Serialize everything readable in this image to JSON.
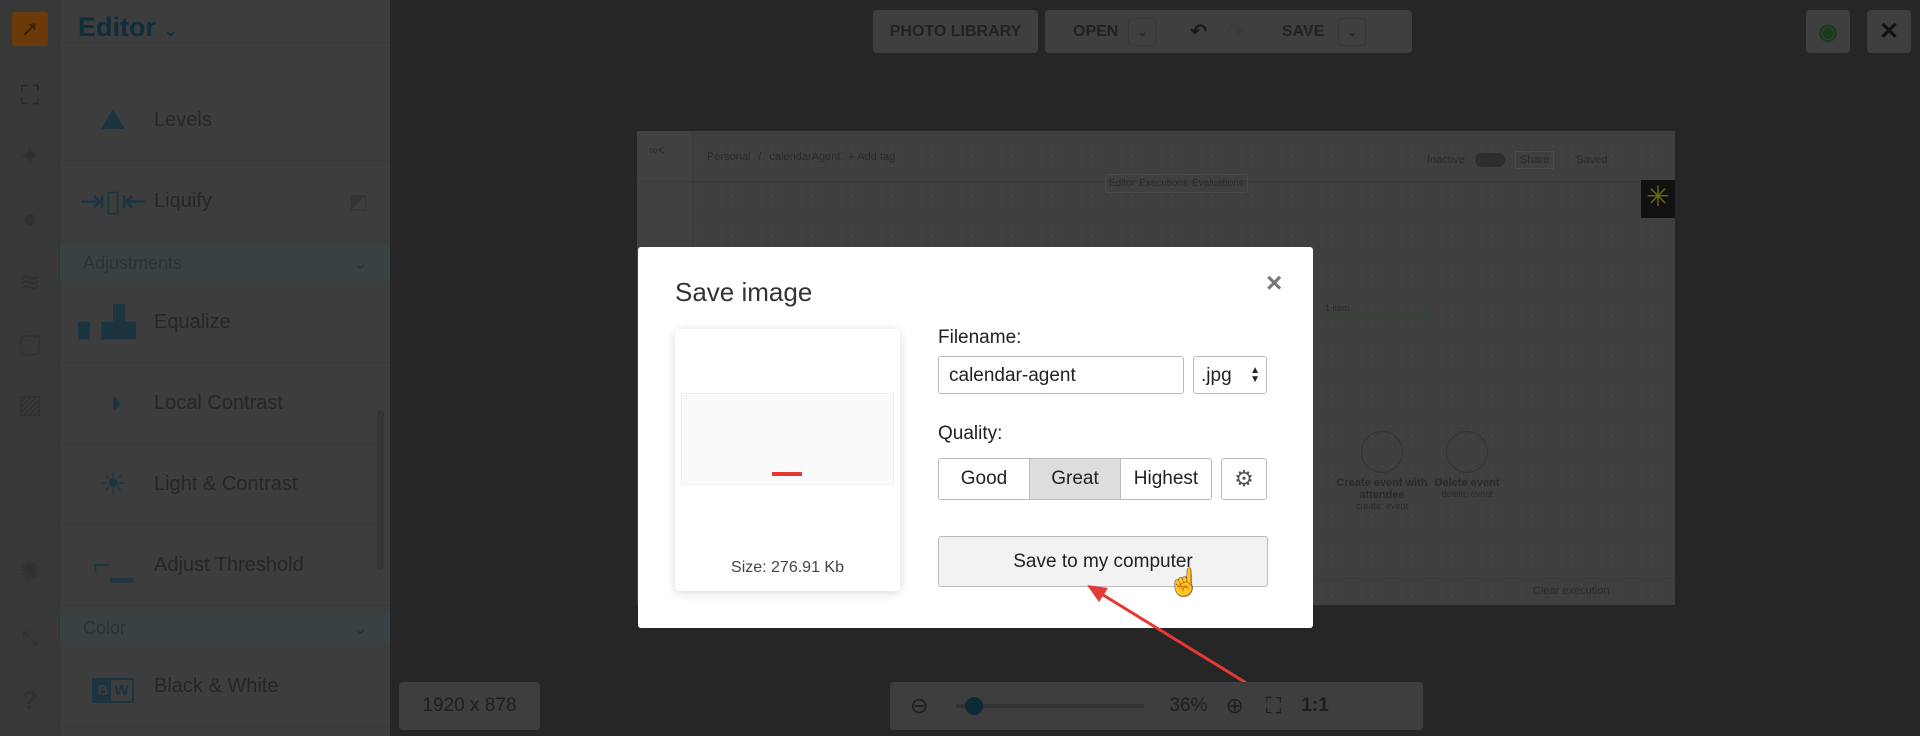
{
  "sidebar": {
    "title": "Editor",
    "tools": [
      "crop-icon",
      "magic-wand-icon",
      "face-icon",
      "layers-icon",
      "frame-icon",
      "texture-icon",
      "lightbulb-icon",
      "expand-icon",
      "help-icon"
    ],
    "items": [
      {
        "label": "Levels",
        "icon": "mountains-icon"
      },
      {
        "label": "Liquify",
        "icon": "liquify-icon"
      }
    ],
    "adjustments": {
      "header": "Adjustments",
      "items": [
        {
          "label": "Equalize"
        },
        {
          "label": "Local Contrast"
        },
        {
          "label": "Light & Contrast"
        },
        {
          "label": "Adjust Threshold"
        }
      ]
    },
    "color": {
      "header": "Color",
      "items": [
        {
          "label": "Black & White",
          "badge_b": "B",
          "badge_w": "W"
        }
      ]
    }
  },
  "toolbar": {
    "photo_library": "PHOTO LIBRARY",
    "open": "OPEN",
    "save": "SAVE"
  },
  "background_canvas": {
    "breadcrumb_personal": "Personal",
    "breadcrumb_sep": "/",
    "workflow_name": "calendarAgent",
    "add_tag": "+ Add tag",
    "tabs": [
      "Editor",
      "Executions",
      "Evaluations"
    ],
    "inactive": "Inactive",
    "share": "Share",
    "saved": "Saved",
    "item_count": "1 item",
    "nodes": [
      {
        "title": "Create event with attendee",
        "subtitle": "create: event"
      },
      {
        "title": "Delete event",
        "subtitle": "delete: event"
      }
    ],
    "clear_execution": "Clear execution"
  },
  "dialog": {
    "title": "Save image",
    "close": "×",
    "size": "Size: 276.91 Kb",
    "filename_label": "Filename:",
    "filename": "calendar-agent",
    "extension": ".jpg",
    "quality_label": "Quality:",
    "quality_options": [
      "Good",
      "Great",
      "Highest"
    ],
    "quality_selected": "Great",
    "save_button": "Save to my computer"
  },
  "footer": {
    "dimensions": "1920 x 878",
    "zoom": "36%",
    "zoom_fraction": 0.05,
    "one_to_one": "1:1"
  },
  "colors": {
    "accent": "#0f2e3d",
    "annotation_arrow": "#e53935",
    "logo": "#6b3a08"
  }
}
